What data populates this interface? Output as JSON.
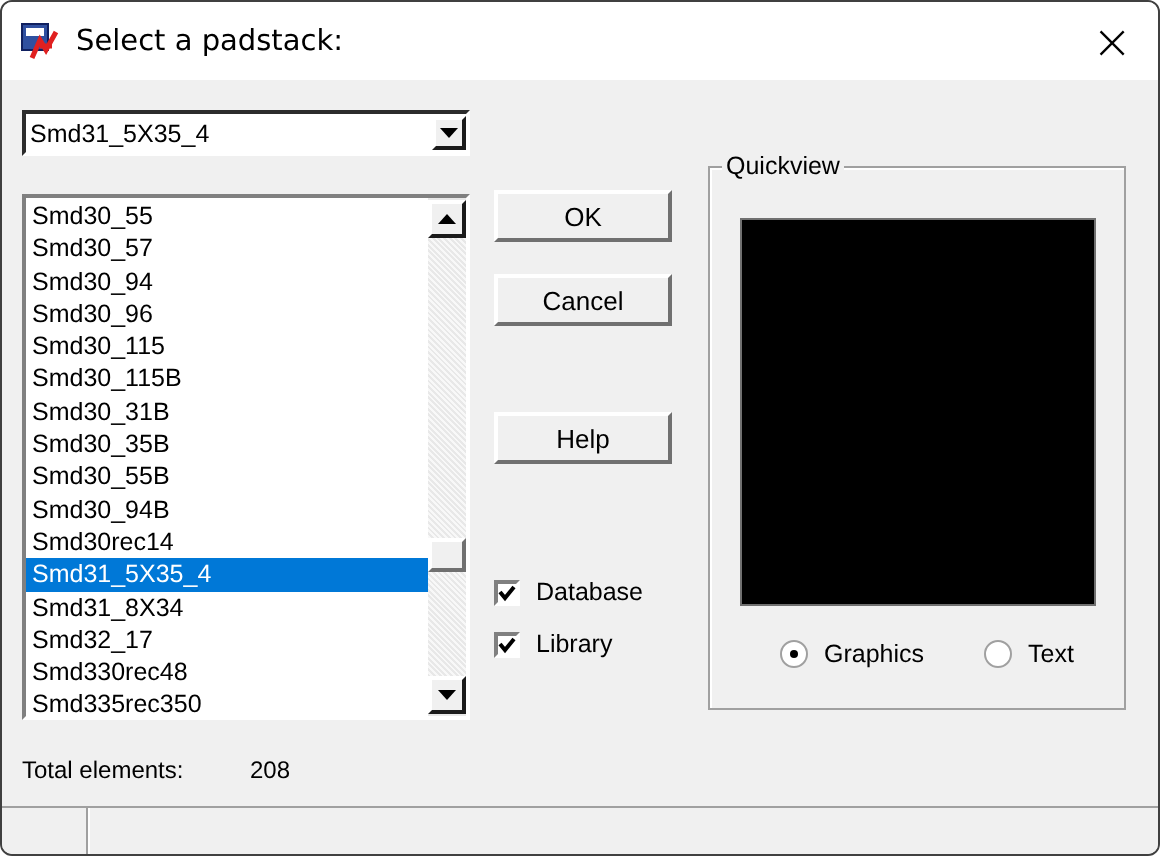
{
  "window": {
    "title": "Select a padstack:",
    "close": "×"
  },
  "combo": {
    "value": "Smd31_5X35_4"
  },
  "list": {
    "items": [
      {
        "label": "Smd30_55",
        "selected": false
      },
      {
        "label": "Smd30_57",
        "selected": false
      },
      {
        "label": "Smd30_94",
        "selected": false
      },
      {
        "label": "Smd30_96",
        "selected": false
      },
      {
        "label": "Smd30_115",
        "selected": false
      },
      {
        "label": "Smd30_115B",
        "selected": false
      },
      {
        "label": "Smd30_31B",
        "selected": false
      },
      {
        "label": "Smd30_35B",
        "selected": false
      },
      {
        "label": "Smd30_55B",
        "selected": false
      },
      {
        "label": "Smd30_94B",
        "selected": false
      },
      {
        "label": "Smd30rec14",
        "selected": false
      },
      {
        "label": "Smd31_5X35_4",
        "selected": true
      },
      {
        "label": "Smd31_8X34",
        "selected": false
      },
      {
        "label": "Smd32_17",
        "selected": false
      },
      {
        "label": "Smd330rec48",
        "selected": false
      },
      {
        "label": "Smd335rec350",
        "selected": false
      }
    ]
  },
  "buttons": [
    "OK",
    "Cancel",
    "Help"
  ],
  "checkboxes": [
    {
      "label": "Database",
      "checked": true
    },
    {
      "label": "Library",
      "checked": true
    }
  ],
  "quickview": {
    "title": "Quickview",
    "options": [
      {
        "label": "Graphics",
        "selected": true
      },
      {
        "label": "Text",
        "selected": false
      }
    ]
  },
  "footer": {
    "label": "Total elements:",
    "value": "208"
  }
}
